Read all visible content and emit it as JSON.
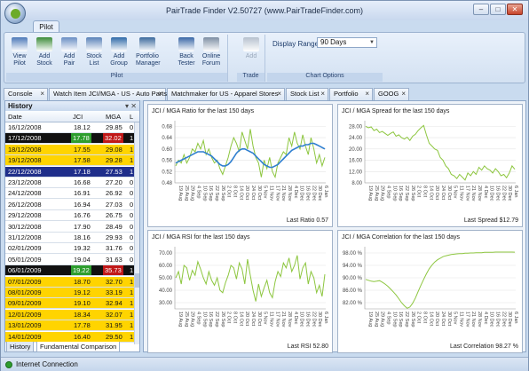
{
  "window": {
    "title": "PairTrade Finder V2.50727 (www.PairTradeFinder.com)"
  },
  "ribbon": {
    "tab": "Pilot",
    "groups": [
      {
        "label": "Pilot",
        "buttons": [
          {
            "label": "View\nPilot",
            "icon": "view-pilot-icon",
            "color": "#4d79b8"
          },
          {
            "label": "Add\nStock",
            "icon": "add-stock-icon",
            "color": "#3d8c3a"
          },
          {
            "label": "Add\nPair",
            "icon": "add-pair-icon",
            "color": "#6a8fc4"
          },
          {
            "label": "Stock\nList",
            "icon": "stock-list-icon",
            "color": "#5a82b8"
          },
          {
            "label": "Add\nGroup",
            "icon": "add-group-icon",
            "color": "#2f6aa8"
          },
          {
            "label": "Portfolio\nManager",
            "icon": "portfolio-manager-icon",
            "color": "#3c6a9d"
          },
          {
            "label": "Back\nTester",
            "icon": "back-tester-icon",
            "color": "#3a67a6"
          },
          {
            "label": "Online\nForum",
            "icon": "online-forum-icon",
            "color": "#7d8ea3"
          }
        ]
      },
      {
        "label": "Trade",
        "buttons": [
          {
            "label": "Add",
            "icon": "add-trade-icon",
            "color": "#b6c1cf"
          }
        ]
      },
      {
        "label": "Chart Options",
        "display_range_label": "Display Range",
        "display_range_value": "90 Days"
      }
    ]
  },
  "doc_tabs": [
    "Console",
    "Watch Item JCI/MGA - US - Auto Parts",
    "Matchmaker for US - Apparel Stores",
    "Stock List",
    "Portfolio",
    "GOOG"
  ],
  "history": {
    "title": "History",
    "columns": [
      "Date",
      "JCI",
      "MGA",
      "L"
    ],
    "rows": [
      {
        "date": "16/12/2008",
        "jci": "18.12",
        "mga": "29.85",
        "l": "0",
        "style": "white"
      },
      {
        "date": "17/12/2008",
        "jci": "17.78",
        "mga": "32.02",
        "l": "1",
        "style": "black"
      },
      {
        "date": "18/12/2008",
        "jci": "17.55",
        "mga": "29.08",
        "l": "1",
        "style": "yellow"
      },
      {
        "date": "19/12/2008",
        "jci": "17.58",
        "mga": "29.28",
        "l": "1",
        "style": "yellow"
      },
      {
        "date": "22/12/2008",
        "jci": "17.18",
        "mga": "27.53",
        "l": "1",
        "style": "navy"
      },
      {
        "date": "23/12/2008",
        "jci": "16.68",
        "mga": "27.20",
        "l": "0",
        "style": "white"
      },
      {
        "date": "24/12/2008",
        "jci": "16.91",
        "mga": "26.92",
        "l": "0",
        "style": "white"
      },
      {
        "date": "26/12/2008",
        "jci": "16.94",
        "mga": "27.03",
        "l": "0",
        "style": "white"
      },
      {
        "date": "29/12/2008",
        "jci": "16.76",
        "mga": "26.75",
        "l": "0",
        "style": "white"
      },
      {
        "date": "30/12/2008",
        "jci": "17.90",
        "mga": "28.49",
        "l": "0",
        "style": "white"
      },
      {
        "date": "31/12/2008",
        "jci": "18.16",
        "mga": "29.93",
        "l": "0",
        "style": "white"
      },
      {
        "date": "02/01/2009",
        "jci": "19.32",
        "mga": "31.76",
        "l": "0",
        "style": "white"
      },
      {
        "date": "05/01/2009",
        "jci": "19.04",
        "mga": "31.63",
        "l": "0",
        "style": "white"
      },
      {
        "date": "06/01/2009",
        "jci": "19.22",
        "mga": "35.73",
        "l": "1",
        "style": "black"
      },
      {
        "date": "07/01/2009",
        "jci": "18.70",
        "mga": "32.70",
        "l": "1",
        "style": "yellow"
      },
      {
        "date": "08/01/2009",
        "jci": "19.12",
        "mga": "33.19",
        "l": "1",
        "style": "yellow"
      },
      {
        "date": "09/01/2009",
        "jci": "19.10",
        "mga": "32.94",
        "l": "1",
        "style": "yellow"
      },
      {
        "date": "12/01/2009",
        "jci": "18.34",
        "mga": "32.07",
        "l": "1",
        "style": "yellow"
      },
      {
        "date": "13/01/2009",
        "jci": "17.78",
        "mga": "31.95",
        "l": "1",
        "style": "yellow"
      },
      {
        "date": "14/01/2009",
        "jci": "16.40",
        "mga": "29.50",
        "l": "1",
        "style": "yellow"
      }
    ],
    "tabs": [
      "History",
      "Fundamental Comparison"
    ]
  },
  "status": {
    "text": "Internet Connection",
    "color": "#2e9d2e"
  },
  "x_ticks": [
    "19 Aug",
    "25 Aug",
    "29 Aug",
    "4 Sep",
    "10 Sep",
    "16 Sep",
    "22 Sep",
    "26 Sep",
    "2 Oct",
    "8 Oct",
    "14 Oct",
    "20 Oct",
    "24 Oct",
    "30 Oct",
    "5 Nov",
    "11 Nov",
    "17 Nov",
    "21 Nov",
    "28 Nov",
    "4 Dec",
    "10 Dec",
    "16 Dec",
    "22 Dec",
    "30 Dec",
    "6 Jan"
  ],
  "chart_data": [
    {
      "type": "line",
      "title": "JCI / MGA Ratio  for the last 150 days",
      "footer": "Last Ratio 0.57",
      "yticks": [
        "0.68",
        "0.64",
        "0.60",
        "0.56",
        "0.52",
        "0.48"
      ],
      "ylim": [
        0.48,
        0.7
      ],
      "series": [
        {
          "color": "#8dc63f",
          "values": [
            0.54,
            0.56,
            0.55,
            0.58,
            0.55,
            0.57,
            0.6,
            0.59,
            0.62,
            0.6,
            0.63,
            0.58,
            0.6,
            0.57,
            0.55,
            0.56,
            0.53,
            0.51,
            0.54,
            0.57,
            0.61,
            0.64,
            0.62,
            0.59,
            0.66,
            0.63,
            0.6,
            0.67,
            0.61,
            0.57,
            0.55,
            0.5,
            0.56,
            0.53,
            0.57,
            0.52,
            0.5,
            0.55,
            0.57,
            0.59,
            0.58,
            0.64,
            0.61,
            0.66,
            0.62,
            0.6,
            0.65,
            0.61,
            0.58,
            0.64,
            0.6,
            0.55,
            0.58,
            0.54,
            0.57
          ]
        },
        {
          "color": "#2f7fd0",
          "values": [
            0.55,
            0.555,
            0.56,
            0.565,
            0.57,
            0.575,
            0.58,
            0.585,
            0.59,
            0.59,
            0.59,
            0.585,
            0.58,
            0.575,
            0.565,
            0.555,
            0.545,
            0.54,
            0.54,
            0.545,
            0.555,
            0.57,
            0.585,
            0.595,
            0.6,
            0.6,
            0.595,
            0.59,
            0.585,
            0.575,
            0.565,
            0.555,
            0.545,
            0.54,
            0.535,
            0.535,
            0.54,
            0.545,
            0.555,
            0.565,
            0.575,
            0.585,
            0.595,
            0.6,
            0.605,
            0.61,
            0.61,
            0.615,
            0.615,
            0.62,
            0.62,
            0.615,
            0.61,
            0.605,
            0.6
          ]
        }
      ]
    },
    {
      "type": "line",
      "title": "JCI / MGA Spread  for the last 150 days",
      "footer": "Last Spread $12.79",
      "yticks": [
        "28.00",
        "24.00",
        "20.00",
        "16.00",
        "12.00",
        "8.00"
      ],
      "ylim": [
        8,
        30
      ],
      "series": [
        {
          "color": "#8dc63f",
          "values": [
            28,
            27.5,
            27.8,
            26.5,
            27,
            25.8,
            26.2,
            25.5,
            24.8,
            25.5,
            26,
            24.5,
            25,
            24,
            23.5,
            24.2,
            23,
            24.5,
            25.2,
            26.5,
            27.5,
            28.3,
            25,
            22,
            21,
            20,
            19.5,
            17,
            16,
            14,
            13,
            11,
            10.5,
            9.5,
            11,
            10,
            9,
            11.5,
            10.5,
            12,
            11,
            13.5,
            12.5,
            14,
            13,
            12.5,
            11.5,
            13,
            12,
            10.5,
            11,
            9.8,
            11.5,
            14,
            12.8
          ]
        }
      ]
    },
    {
      "type": "line",
      "title": "JCI / MGA RSI  for the last 150 days",
      "footer": "Last RSI 52.80",
      "yticks": [
        "70.00",
        "60.00",
        "50.00",
        "40.00",
        "30.00"
      ],
      "ylim": [
        25,
        75
      ],
      "series": [
        {
          "color": "#8dc63f",
          "values": [
            50,
            55,
            45,
            60,
            58,
            48,
            56,
            52,
            63,
            57,
            50,
            45,
            55,
            48,
            44,
            50,
            40,
            38,
            46,
            52,
            60,
            58,
            49,
            62,
            57,
            45,
            65,
            52,
            40,
            31,
            45,
            35,
            42,
            48,
            38,
            34,
            47,
            55,
            51,
            62,
            58,
            66,
            55,
            60,
            68,
            49,
            58,
            62,
            45,
            55,
            50,
            38,
            44,
            35,
            52.8
          ]
        }
      ]
    },
    {
      "type": "line",
      "title": "JCI / MGA Correlation  for the last 150 days",
      "footer": "Last Correlation 98.27 %",
      "yticks": [
        "98.00 %",
        "94.00 %",
        "90.00 %",
        "86.00 %",
        "82.00 %"
      ],
      "ylim": [
        80,
        100
      ],
      "series": [
        {
          "color": "#8dc63f",
          "values": [
            89.5,
            89.2,
            88.9,
            88.8,
            88.9,
            89.1,
            88.6,
            88.0,
            87.3,
            86.4,
            85.5,
            84.5,
            83.3,
            82.0,
            81.0,
            80.2,
            80.6,
            81.8,
            83.5,
            85.6,
            87.6,
            89.5,
            91.3,
            92.9,
            94.1,
            95.1,
            95.8,
            96.3,
            96.8,
            97.1,
            97.3,
            97.5,
            97.6,
            97.7,
            97.8,
            97.8,
            97.9,
            97.9,
            98.0,
            98.0,
            98.1,
            98.1,
            98.1,
            98.2,
            98.2,
            98.2,
            98.2,
            98.3,
            98.3,
            98.3,
            98.3,
            98.3,
            98.3,
            98.3,
            98.27
          ]
        }
      ]
    }
  ]
}
